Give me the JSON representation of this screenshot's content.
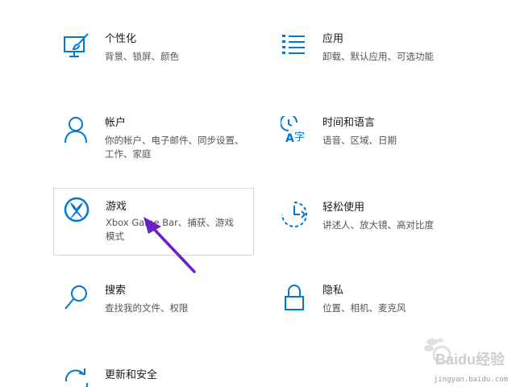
{
  "accent_color": "#0078d7",
  "annotation_arrow_color": "#6a1fc9",
  "settings": [
    {
      "title": "个性化",
      "description": "背景、锁屏、颜色",
      "icon": "personalization-icon"
    },
    {
      "title": "应用",
      "description": "卸载、默认应用、可选功能",
      "icon": "apps-icon"
    },
    {
      "title": "帐户",
      "description": "你的帐户、电子邮件、同步设置、工作、家庭",
      "icon": "account-icon"
    },
    {
      "title": "时间和语言",
      "description": "语音、区域、日期",
      "icon": "time-language-icon"
    },
    {
      "title": "游戏",
      "description": "Xbox Game Bar、捕获、游戏模式",
      "icon": "xbox-icon"
    },
    {
      "title": "轻松使用",
      "description": "讲述人、放大镜、高对比度",
      "icon": "ease-of-access-icon"
    },
    {
      "title": "搜索",
      "description": "查找我的文件、权限",
      "icon": "search-icon"
    },
    {
      "title": "隐私",
      "description": "位置、相机、麦克风",
      "icon": "lock-icon"
    },
    {
      "title": "更新和安全",
      "description": "",
      "icon": "update-icon"
    }
  ],
  "watermark": {
    "brand": "Baidu经验",
    "url": "jingyan.baidu.com"
  }
}
